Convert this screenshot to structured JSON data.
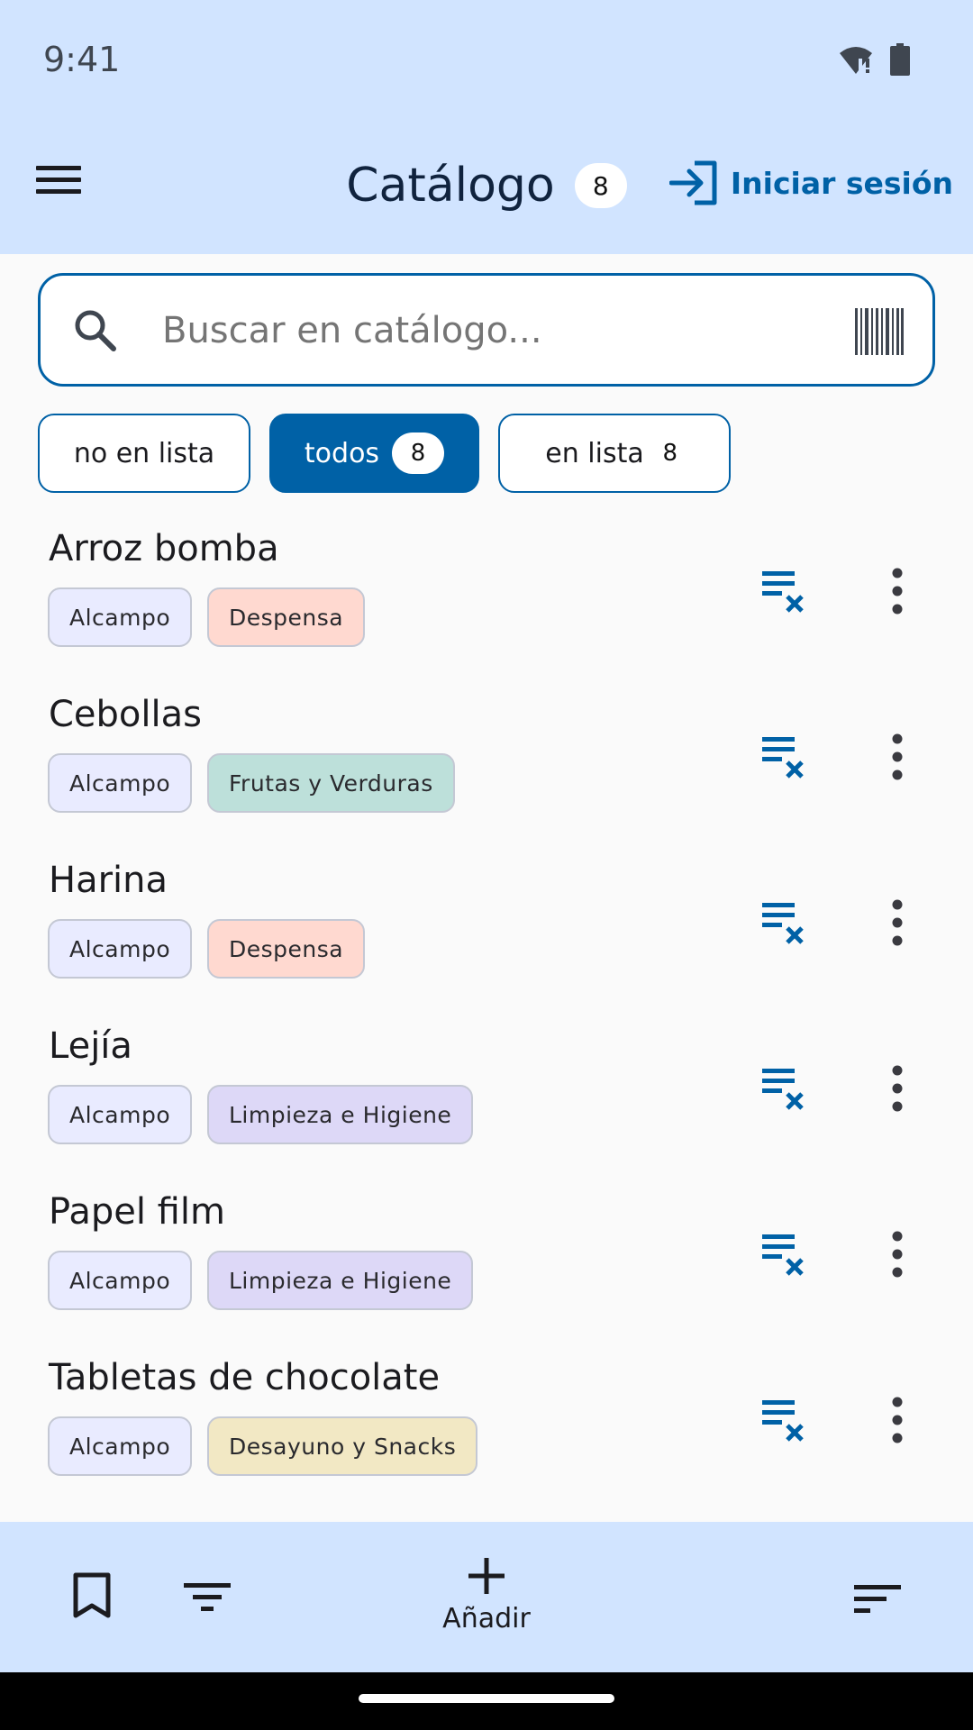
{
  "status": {
    "time": "9:41"
  },
  "header": {
    "title": "Catálogo",
    "count": "8",
    "login_label": "Iniciar sesión"
  },
  "search": {
    "placeholder": "Buscar en catálogo...",
    "value": ""
  },
  "filters": {
    "not_in_list": {
      "label": "no en lista"
    },
    "all": {
      "label": "todos",
      "count": "8"
    },
    "in_list": {
      "label": "en lista",
      "count": "8"
    }
  },
  "items": [
    {
      "name": "Arroz bomba",
      "store": "Alcampo",
      "category": "Despensa",
      "category_color": "#ffd9d0"
    },
    {
      "name": "Cebollas",
      "store": "Alcampo",
      "category": "Frutas y Verduras",
      "category_color": "#bde0da"
    },
    {
      "name": "Harina",
      "store": "Alcampo",
      "category": "Despensa",
      "category_color": "#ffd9d0"
    },
    {
      "name": "Lejía",
      "store": "Alcampo",
      "category": "Limpieza e Higiene",
      "category_color": "#ddd8f7"
    },
    {
      "name": "Papel film",
      "store": "Alcampo",
      "category": "Limpieza e Higiene",
      "category_color": "#ddd8f7"
    },
    {
      "name": "Tabletas de chocolate",
      "store": "Alcampo",
      "category": "Desayuno y Snacks",
      "category_color": "#f2e8c4"
    }
  ],
  "bottom_bar": {
    "add_label": "Añadir"
  },
  "colors": {
    "accent": "#0061a6",
    "bar_background": "#d1e4ff"
  }
}
